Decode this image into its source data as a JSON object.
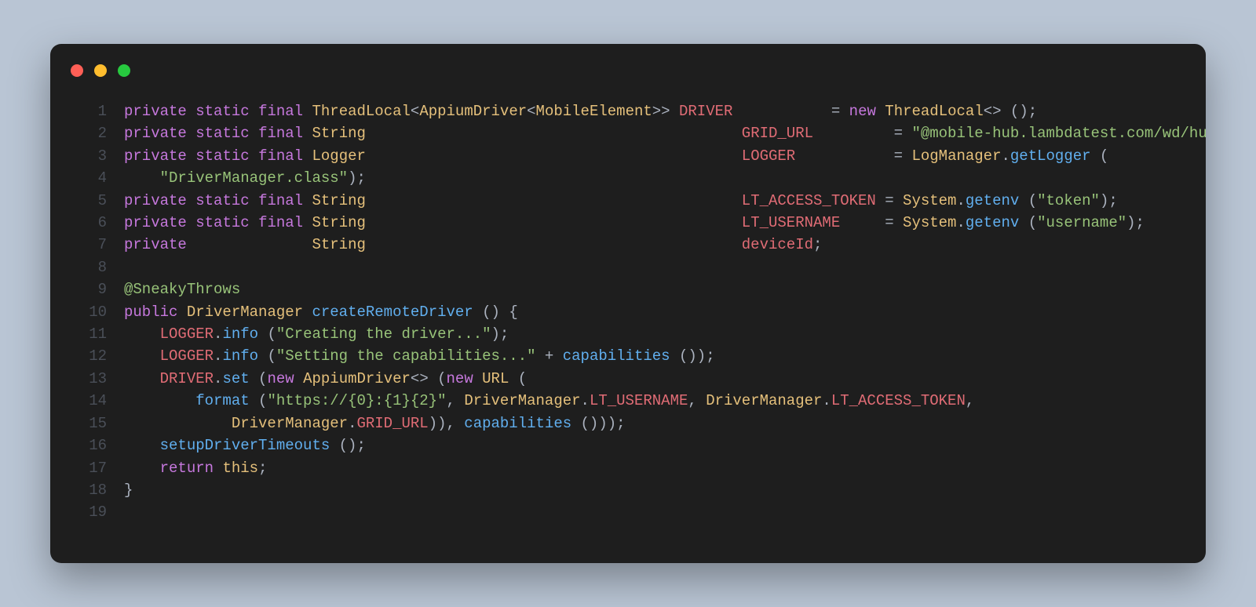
{
  "window": {
    "traffic": {
      "red": "#ff5f56",
      "yellow": "#ffbd2e",
      "green": "#27c93f"
    }
  },
  "gutter": {
    "l1": "1",
    "l2": "2",
    "l3": "3",
    "l4": "4",
    "l5": "5",
    "l6": "6",
    "l7": "7",
    "l8": "8",
    "l9": "9",
    "l10": "10",
    "l11": "11",
    "l12": "12",
    "l13": "13",
    "l14": "14",
    "l15": "15",
    "l16": "16",
    "l17": "17",
    "l18": "18",
    "l19": "19"
  },
  "tok": {
    "private": "private",
    "static": "static",
    "final": "final",
    "public": "public",
    "new": "new",
    "return": "return",
    "this": "this",
    "ThreadLocal": "ThreadLocal",
    "AppiumDriver": "AppiumDriver",
    "MobileElement": "MobileElement",
    "String": "String",
    "Logger": "Logger",
    "LogManager": "LogManager",
    "System": "System",
    "URL": "URL",
    "DriverManager": "DriverManager",
    "DRIVER": "DRIVER",
    "GRID_URL": "GRID_URL",
    "LOGGER": "LOGGER",
    "LT_ACCESS_TOKEN": "LT_ACCESS_TOKEN",
    "LT_USERNAME": "LT_USERNAME",
    "deviceId": "deviceId",
    "SneakyThrows": "@SneakyThrows",
    "createRemoteDriver": "createRemoteDriver",
    "info": "info",
    "set": "set",
    "getenv": "getenv",
    "getLogger": "getLogger",
    "format": "format",
    "setupDriverTimeouts": "setupDriverTimeouts",
    "capabilities": "capabilities",
    "str_grid": "\"@mobile-hub.lambdatest.com/wd/hub\"",
    "str_dm": "\"DriverManager.class\"",
    "str_token": "\"token\"",
    "str_username": "\"username\"",
    "str_creating": "\"Creating the driver...\"",
    "str_setting": "\"Setting the capabilities...\"",
    "str_url": "\"https://{0}:{1}{2}\"",
    "eq": " = ",
    "semi": ";",
    "lt": "<",
    "gt": ">",
    "gt2": ">>",
    "comma": ",",
    "plus": " + ",
    "lp": " (",
    "rp": ")",
    "lb": " {",
    "rb": "}",
    "dcolon": ".",
    "dot": ".",
    "empty": "<> ()",
    "pad1": "                                          ",
    "pad2": "                   ",
    "pad3": "          ",
    "pad4": "        ",
    "sp": " "
  }
}
